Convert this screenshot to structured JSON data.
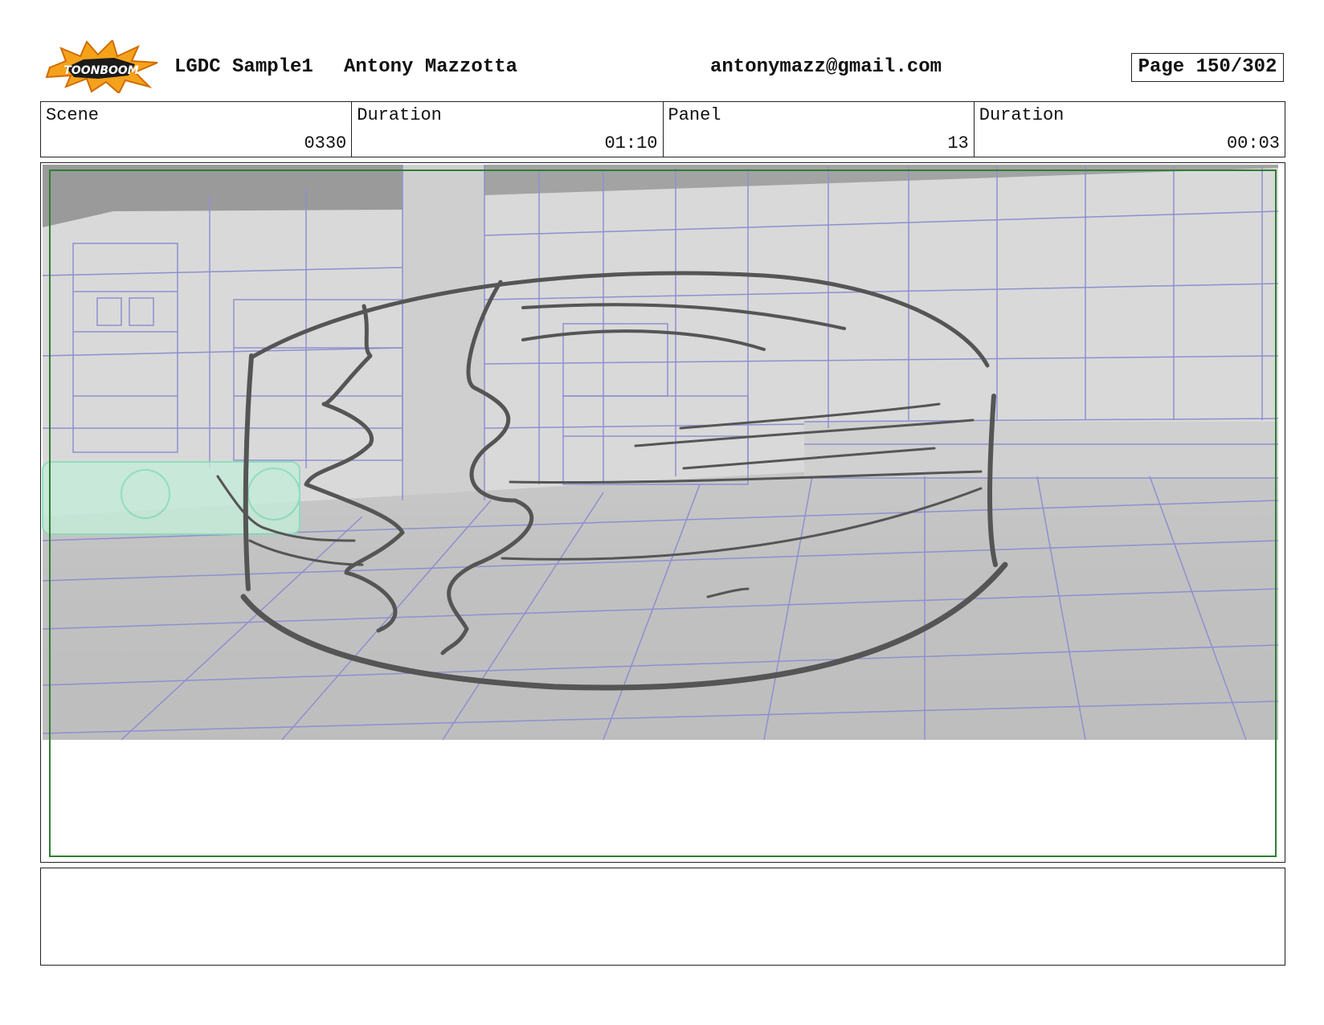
{
  "header": {
    "logo_text": "TOONBOOM",
    "project": "LGDC Sample1",
    "author": "Antony Mazzotta",
    "email": "antonymazz@gmail.com",
    "page": "Page 150/302"
  },
  "info": {
    "scene_label": "Scene",
    "scene_value": "0330",
    "scene_duration_label": "Duration",
    "scene_duration_value": "01:10",
    "panel_label": "Panel",
    "panel_value": "13",
    "panel_duration_label": "Duration",
    "panel_duration_value": "00:03"
  },
  "notes": {
    "text": ""
  },
  "colors": {
    "safe_frame": "#2f7d32",
    "grid_lines": "#8f8fd0",
    "sketch": "#555555",
    "logo_orange": "#f5a21b"
  }
}
